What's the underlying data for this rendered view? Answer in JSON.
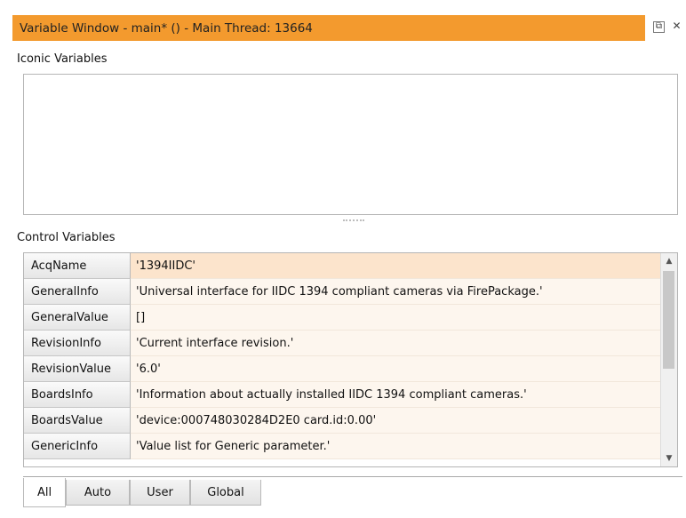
{
  "window": {
    "title": "Variable Window - main* () - Main Thread: 13664",
    "accent_color": "#f39a2e",
    "buttons": [
      {
        "name": "restore-icon",
        "glyph": "⧉"
      },
      {
        "name": "close-icon",
        "glyph": "✕"
      }
    ]
  },
  "iconic": {
    "label": "Iconic Variables"
  },
  "control": {
    "label": "Control Variables",
    "rows": [
      {
        "name": "AcqName",
        "value": "'1394IIDC'"
      },
      {
        "name": "GeneralInfo",
        "value": "'Universal interface for IIDC 1394 compliant cameras via FirePackage.'"
      },
      {
        "name": "GeneralValue",
        "value": "[]"
      },
      {
        "name": "RevisionInfo",
        "value": "'Current interface revision.'"
      },
      {
        "name": "RevisionValue",
        "value": "'6.0'"
      },
      {
        "name": "BoardsInfo",
        "value": "'Information about actually installed IIDC 1394 compliant cameras.'"
      },
      {
        "name": "BoardsValue",
        "value": "'device:000748030284D2E0 card.id:0.00'"
      },
      {
        "name": "GenericInfo",
        "value": "'Value list for Generic parameter.'"
      }
    ]
  },
  "tabs": [
    {
      "label": "All",
      "active": true
    },
    {
      "label": "Auto",
      "active": false
    },
    {
      "label": "User",
      "active": false
    },
    {
      "label": "Global",
      "active": false
    }
  ]
}
